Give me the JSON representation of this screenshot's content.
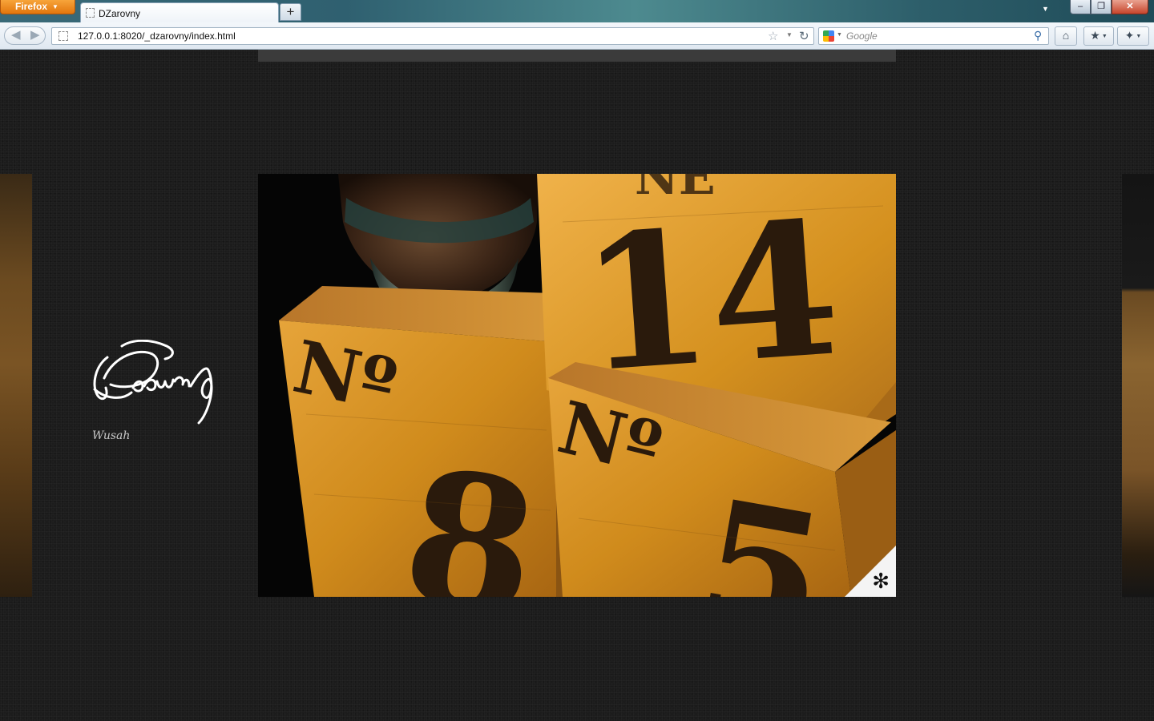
{
  "browser": {
    "menu_button_label": "Firefox",
    "tab_title": "DZarovny",
    "new_tab_label": "+",
    "url": "127.0.0.1:8020/_dzarovny/index.html",
    "search_placeholder": "Google",
    "window_controls": {
      "minimize": "–",
      "maximize": "❐",
      "close": "✕"
    },
    "icons": [
      "back-arrow-icon",
      "forward-arrow-icon",
      "bookmark-star-icon",
      "reload-icon",
      "google-icon",
      "search-magnifier-icon",
      "home-icon",
      "bookmarks-icon",
      "addon-icon"
    ]
  },
  "page": {
    "tagline": "Wusah",
    "photo_corner_symbol": "✻",
    "photo_subject": [
      "Nº",
      "14",
      "Nº",
      "8",
      "Nº",
      "5"
    ],
    "colors": {
      "background": "#1c1c1c",
      "photo_wood": "#d88f22",
      "ink": "#2a1a0c"
    }
  }
}
